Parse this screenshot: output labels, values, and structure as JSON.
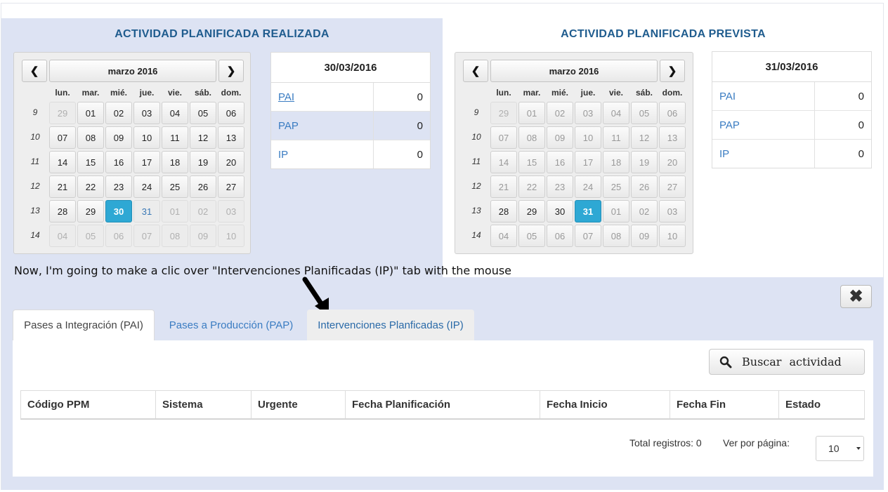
{
  "left": {
    "title": "ACTIVIDAD PLANIFICADA REALIZADA",
    "calendar": {
      "month": "marzo 2016",
      "weekdays": [
        "lun.",
        "mar.",
        "mié.",
        "jue.",
        "vie.",
        "sáb.",
        "dom."
      ],
      "weeks": [
        "9",
        "10",
        "11",
        "12",
        "13",
        "14"
      ],
      "days": [
        [
          "29",
          "01",
          "02",
          "03",
          "04",
          "05",
          "06"
        ],
        [
          "07",
          "08",
          "09",
          "10",
          "11",
          "12",
          "13"
        ],
        [
          "14",
          "15",
          "16",
          "17",
          "18",
          "19",
          "20"
        ],
        [
          "21",
          "22",
          "23",
          "24",
          "25",
          "26",
          "27"
        ],
        [
          "28",
          "29",
          "30",
          "31",
          "01",
          "02",
          "03"
        ],
        [
          "04",
          "05",
          "06",
          "07",
          "08",
          "09",
          "10"
        ]
      ]
    },
    "summary": {
      "date": "30/03/2016",
      "rows": [
        {
          "label": "PAI",
          "value": "0"
        },
        {
          "label": "PAP",
          "value": "0"
        },
        {
          "label": "IP",
          "value": "0"
        }
      ]
    }
  },
  "right": {
    "title": "ACTIVIDAD PLANIFICADA PREVISTA",
    "calendar": {
      "month": "marzo 2016",
      "weekdays": [
        "lun.",
        "mar.",
        "mié.",
        "jue.",
        "vie.",
        "sáb.",
        "dom."
      ],
      "weeks": [
        "9",
        "10",
        "11",
        "12",
        "13",
        "14"
      ],
      "days": [
        [
          "29",
          "01",
          "02",
          "03",
          "04",
          "05",
          "06"
        ],
        [
          "07",
          "08",
          "09",
          "10",
          "11",
          "12",
          "13"
        ],
        [
          "14",
          "15",
          "16",
          "17",
          "18",
          "19",
          "20"
        ],
        [
          "21",
          "22",
          "23",
          "24",
          "25",
          "26",
          "27"
        ],
        [
          "28",
          "29",
          "30",
          "31",
          "01",
          "02",
          "03"
        ],
        [
          "04",
          "05",
          "06",
          "07",
          "08",
          "09",
          "10"
        ]
      ]
    },
    "summary": {
      "date": "31/03/2016",
      "rows": [
        {
          "label": "PAI",
          "value": "0"
        },
        {
          "label": "PAP",
          "value": "0"
        },
        {
          "label": "IP",
          "value": "0"
        }
      ]
    }
  },
  "annotation": "Now, I'm going to make a clic over \"Intervenciones Planificadas (IP)\" tab with the mouse",
  "close_label": "✖",
  "tabs": [
    {
      "label": "Pases a Integración (PAI)"
    },
    {
      "label": "Pases a Producción (PAP)"
    },
    {
      "label": "Intervenciones Planficadas (IP)"
    }
  ],
  "search_label": "Buscar actividad",
  "table": {
    "headers": [
      "Código PPM",
      "Sistema",
      "Urgente",
      "Fecha Planificación",
      "Fecha Inicio",
      "Fecha Fin",
      "Estado"
    ]
  },
  "footer": {
    "total": "Total registros: 0",
    "per_page_label": "Ver por página:",
    "per_page_value": "10"
  },
  "colors": {
    "accent": "#2ea8d4",
    "title": "#1f5c8e",
    "link": "#3a7cc2",
    "band": "#dde3f3"
  }
}
